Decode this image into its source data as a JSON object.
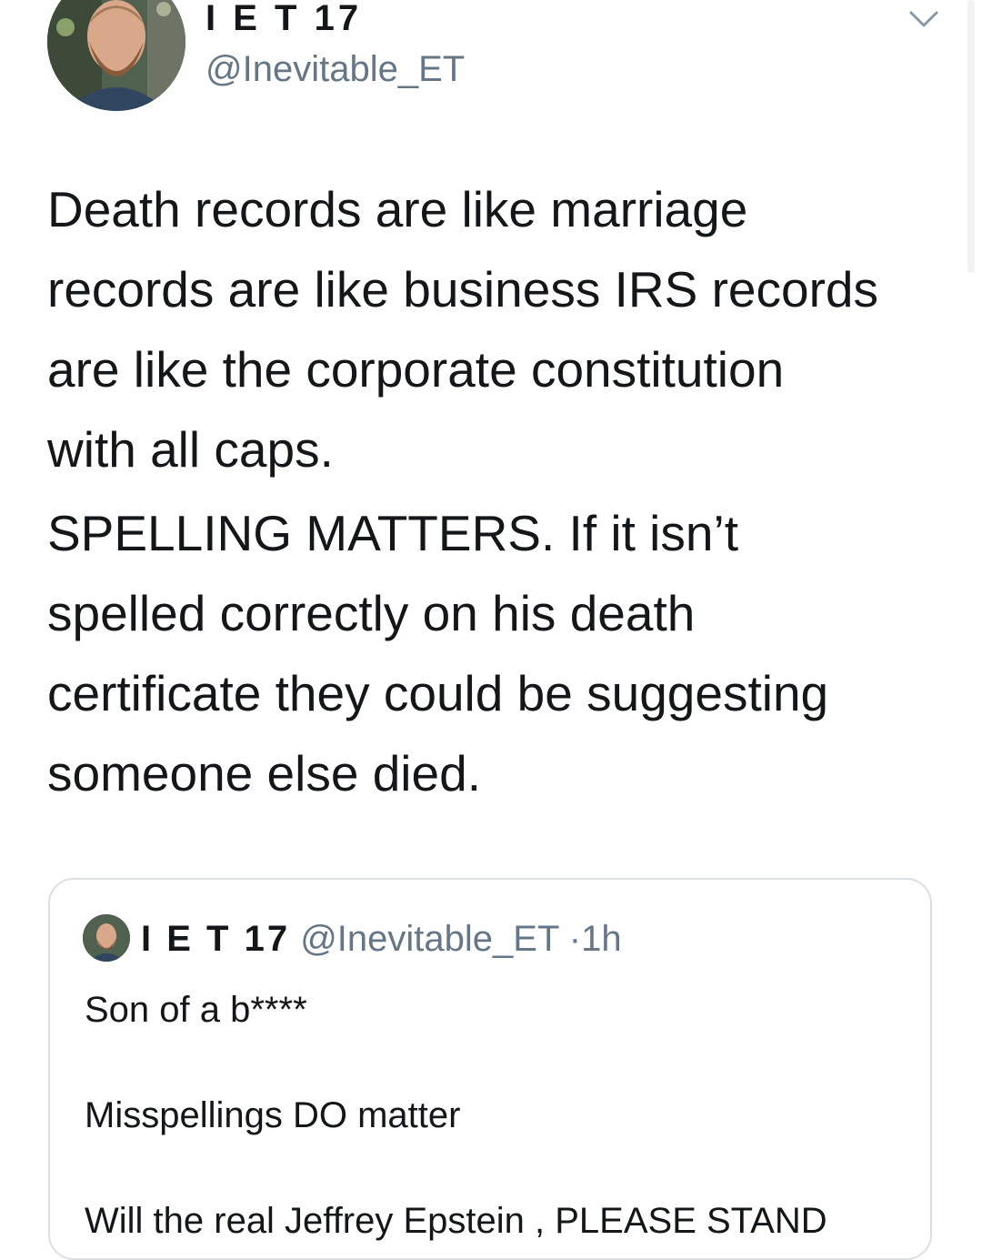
{
  "colors": {
    "text": "#14171a",
    "secondary": "#657786",
    "border": "#dbe0e4"
  },
  "tweet": {
    "display_name": "I E T 17",
    "handle": "@Inevitable_ET",
    "avatar_icon": "profile-avatar",
    "menu_icon": "chevron-down-icon",
    "paragraphs": [
      "Death records are like marriage\nrecords are like business IRS records\nare like the corporate constitution\nwith all caps.",
      "SPELLING MATTERS.  If it isn’t\nspelled correctly on his death\ncertificate they could be suggesting\nsomeone else died."
    ]
  },
  "quoted_tweet": {
    "display_name": "I E T 17",
    "handle": "@Inevitable_ET",
    "separator": "·",
    "time": "1h",
    "lines": [
      "Son of a b****",
      "Misspellings DO matter",
      "Will the real Jeffrey Epstein , PLEASE STAND"
    ]
  }
}
